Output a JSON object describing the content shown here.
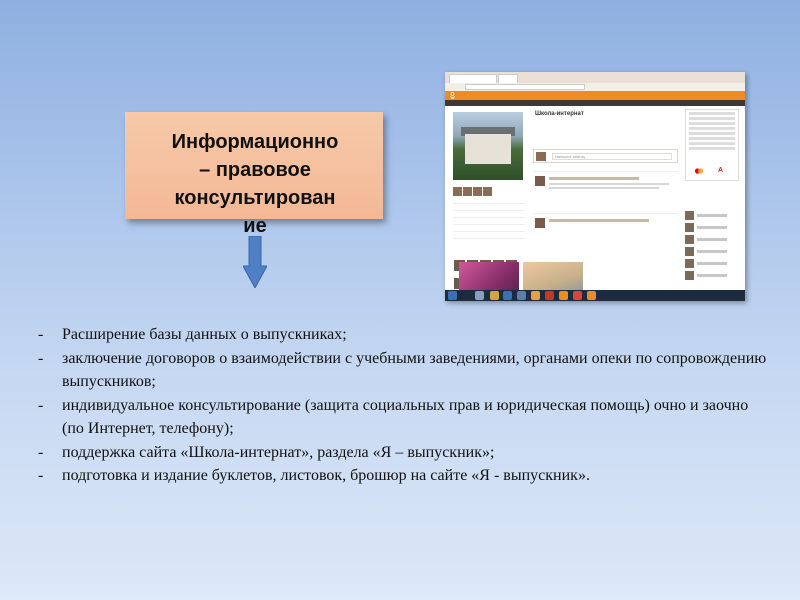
{
  "title": "Информационно\n– правовое\nконсультирован\nие",
  "bullets": [
    "Расширение базы данных о выпускниках;",
    "заключение договоров о взаимодействии с учебными заведениями, органами опеки по сопровождению выпускников;",
    "индивидуальное консультирование (защита социальных прав и юридическая помощь) очно  и заочно (по Интернет, телефону);",
    "поддержка сайта «Школа-интернат», раздела «Я – выпускник»;",
    "подготовка и издание буклетов, листовок, брошюр  на сайте «Я - выпускник»."
  ],
  "bullet_marker": "-",
  "screenshot": {
    "group_title": "Школа-интернат",
    "tabs": [
      "ОК",
      "Одноклассники"
    ],
    "post_placeholder": "Напишите заметку"
  },
  "colors": {
    "title_box": "#f3b896",
    "arrow": "#4f7fc4",
    "ok_orange": "#f08a24"
  },
  "icons": [
    "down-arrow-icon",
    "mastercard-logo-icon",
    "alfa-bank-logo-icon"
  ]
}
